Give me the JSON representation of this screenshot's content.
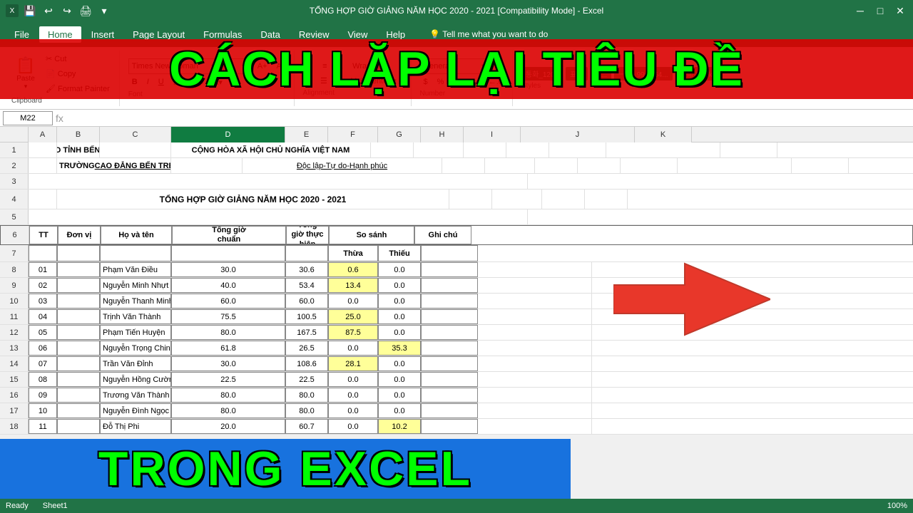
{
  "title_bar": {
    "title": "TỔNG HỢP GIỜ GIẢNG NĂM HỌC 2020 - 2021 [Compatibility Mode]  -  Excel"
  },
  "menu": {
    "items": [
      "File",
      "Home",
      "Insert",
      "Page Layout",
      "Formulas",
      "Data",
      "Review",
      "View",
      "Help"
    ],
    "active": "Home"
  },
  "ribbon": {
    "font_name": "Times New Roman",
    "font_size": "11",
    "wrap_text": "Wrap Text",
    "number_format": "General"
  },
  "formula_bar": {
    "cell_ref": "M22",
    "formula": ""
  },
  "columns": [
    "A",
    "B",
    "C",
    "D",
    "E",
    "F",
    "G",
    "H",
    "I",
    "J",
    "K"
  ],
  "overlay": {
    "top_text": "CÁCH LẶP LẠI TIÊU ĐỀ",
    "bottom_text": "TRONG EXCEL"
  },
  "sheet_title": "TỔNG HỢP GIỜ GIẢNG NĂM HỌC 2020 - 2021",
  "header1_left": "UBND TỈNH BẾN TRE",
  "header1_right": "CỘNG HÒA XÃ HỘI CHỦ NGHĨA VIỆT NAM",
  "header2_left": "TRƯỜNG CAO ĐẲNG BẾN TRE",
  "header2_right": "Độc lập-Tự do-Hạnh phúc",
  "table_headers": {
    "tt": "TT",
    "don_vi": "Đơn vị",
    "ho_ten": "Họ và tên",
    "tong_gio_chuan": "Tổng giờ chuẩn",
    "tong_gio_thuc": "Tổng giờ thực hiện",
    "so_sanh": "So sánh",
    "thua": "Thừa",
    "thieu": "Thiếu",
    "ghi_chu": "Ghi chú"
  },
  "rows": [
    {
      "tt": "01",
      "don_vi": "",
      "ho_ten": "Phạm Văn Điều",
      "chuan": "30.0",
      "thuc": "30.6",
      "thua": "0.6",
      "thieu": "0.0"
    },
    {
      "tt": "02",
      "don_vi": "",
      "ho_ten": "Nguyễn Minh Nhựt",
      "chuan": "40.0",
      "thuc": "53.4",
      "thua": "13.4",
      "thieu": "0.0"
    },
    {
      "tt": "03",
      "don_vi": "",
      "ho_ten": "Nguyễn Thanh Minh",
      "chuan": "60.0",
      "thuc": "60.0",
      "thua": "0.0",
      "thieu": "0.0"
    },
    {
      "tt": "04",
      "don_vi": "",
      "ho_ten": "Trịnh Văn Thành",
      "chuan": "75.5",
      "thuc": "100.5",
      "thua": "25.0",
      "thieu": "0.0"
    },
    {
      "tt": "05",
      "don_vi": "",
      "ho_ten": "Phạm Tiến Huyện",
      "chuan": "80.0",
      "thuc": "167.5",
      "thua": "87.5",
      "thieu": "0.0"
    },
    {
      "tt": "06",
      "don_vi": "",
      "ho_ten": "Nguyễn Trọng Chinh",
      "chuan": "61.8",
      "thuc": "26.5",
      "thua": "0.0",
      "thieu": "35.3"
    },
    {
      "tt": "07",
      "don_vi": "",
      "ho_ten": "Trần Văn Đỉnh",
      "chuan": "30.0",
      "thuc": "108.6",
      "thua": "28.1",
      "thieu": "0.0"
    },
    {
      "tt": "08",
      "don_vi": "",
      "ho_ten": "Nguyễn Hồng Cường",
      "chuan": "22.5",
      "thuc": "22.5",
      "thua": "0.0",
      "thieu": "0.0"
    },
    {
      "tt": "09",
      "don_vi": "",
      "ho_ten": "Trương Văn Thành",
      "chuan": "80.0",
      "thuc": "80.0",
      "thua": "0.0",
      "thieu": "0.0"
    },
    {
      "tt": "10",
      "don_vi": "",
      "ho_ten": "Nguyễn Đình Ngọc Phú",
      "chuan": "80.0",
      "thuc": "80.0",
      "thua": "0.0",
      "thieu": "0.0"
    },
    {
      "tt": "11",
      "don_vi": "",
      "ho_ten": "Đỗ Thị Phi",
      "chuan": "20.0",
      "thuc": "60.7",
      "thua": "0.0",
      "thieu": "10.2"
    }
  ],
  "status": {
    "sheet": "Sheet1",
    "ready": "Ready"
  }
}
